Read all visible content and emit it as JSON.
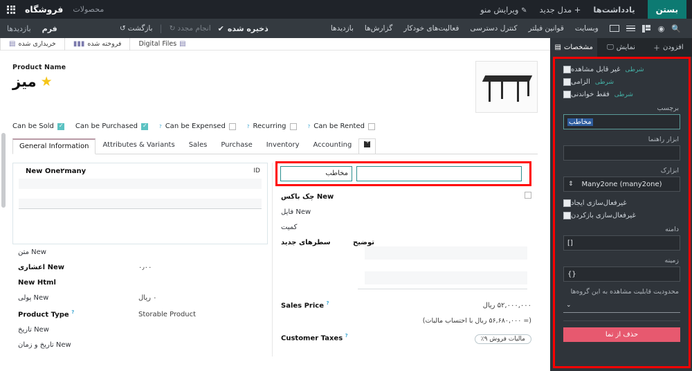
{
  "topbar": {
    "brand": "فروشگاه",
    "apps_icon": "apps-grid-icon",
    "products_link": "محصولات",
    "edit_menu": "ویرایش منو",
    "new_model": "+ مدل جدید",
    "notes": "یادداشت‌ها",
    "close_label": "بستن"
  },
  "secondbar": {
    "breadcrumb_views": "بازدیدها",
    "breadcrumb_form": "فرم",
    "menu_items": [
      "بازدیدها",
      "گزارش‌ها",
      "فعالیت‌های خودکار",
      "کنترل دسترسی",
      "قوانین فیلتر",
      "وبسایت"
    ],
    "undo": "بازگشت",
    "redo": "انجام مجدد",
    "saved": "ذخیره شده",
    "icons": [
      "search-icon",
      "clock-icon",
      "kanban-view-icon",
      "list-view-icon",
      "card-view-icon"
    ]
  },
  "statbar": {
    "buttons": [
      {
        "label": "خریداری شده",
        "icon": "purchase-icon"
      },
      {
        "label": "فروخته شده",
        "icon": "bar-chart-icon"
      },
      {
        "label": "Digital Files",
        "icon": "files-icon"
      }
    ]
  },
  "product": {
    "image_alt": "desk-product-image",
    "name_label": "Product Name",
    "name": "میز",
    "favorite_icon": "star-icon",
    "checkboxes": [
      {
        "label": "Can be Sold",
        "checked": true,
        "help": true
      },
      {
        "label": "Can be Purchased",
        "checked": true,
        "help": false
      },
      {
        "label": "Can be Expensed",
        "checked": false,
        "help": true
      },
      {
        "label": "Recurring",
        "checked": false,
        "help": true
      },
      {
        "label": "Can be Rented",
        "checked": false,
        "help": true
      }
    ]
  },
  "tabs": {
    "items": [
      "General Information",
      "Attributes & Variants",
      "Sales",
      "Purchase",
      "Inventory",
      "Accounting"
    ],
    "active": "General Information",
    "add_tab_icon": "add-tab-icon"
  },
  "form": {
    "right_column": {
      "o2m_title": "New One۲many",
      "o2m_id_col": "ID",
      "fields": [
        {
          "label": "New متن",
          "value": "",
          "bold": false,
          "help": false
        },
        {
          "label": "New اعشاری",
          "value": "۰٫۰۰",
          "bold": true,
          "help": false
        },
        {
          "label": "New Html",
          "value": "",
          "bold": true,
          "help": false
        },
        {
          "label": "New پولی",
          "value": "۰ ریال",
          "bold": false,
          "help": false
        },
        {
          "label": "Product Type",
          "value": "Storable Product",
          "bold": true,
          "help": true
        },
        {
          "label": "New تاریخ",
          "value": "",
          "bold": false,
          "help": false
        },
        {
          "label": "New تاریخ و زمان",
          "value": "",
          "bold": false,
          "help": false
        }
      ]
    },
    "left_column": {
      "contact_input_value": "مخاطب",
      "contact_input_placeholder": "مخاطب",
      "second_input_value": "",
      "fields": [
        {
          "label": "New چک باکس",
          "bold": true,
          "kind": "checkbox"
        },
        {
          "label": "New فایل",
          "bold": false,
          "kind": "text"
        },
        {
          "label": "کمیت",
          "bold": false,
          "kind": "text"
        },
        {
          "label": "سطرهای جدید",
          "bold": true,
          "kind": "list"
        }
      ],
      "list_column_header": "توضیح",
      "sales_price_label": "Sales Price",
      "sales_price_value": "۵۲,۰۰۰,۰۰۰ ریال",
      "sales_price_note": "(= ۵۶,۶۸۰,۰۰۰ ریال با احتساب مالیات)",
      "customer_taxes_label": "Customer Taxes",
      "customer_taxes_tag": "مالیات فروش ۹٪"
    }
  },
  "right_panel": {
    "tabs": [
      {
        "label": "مشخصات",
        "icon": "properties-icon",
        "active": true
      },
      {
        "label": "نمایش",
        "icon": "monitor-icon",
        "active": false
      },
      {
        "label": "افزودن",
        "icon": "plus-icon",
        "active": false
      }
    ],
    "checkbox_rows": [
      {
        "label": "غیر قابل مشاهده",
        "conditional": "شرطی",
        "checked": false
      },
      {
        "label": "الزامی",
        "conditional": "شرطی",
        "checked": false
      },
      {
        "label": "فقط خواندنی",
        "conditional": "شرطی",
        "checked": false
      }
    ],
    "label_field_label": "برچسب",
    "label_field_value": "مخاطب",
    "tooltip_label": "ابزار راهنما",
    "tooltip_value": "",
    "widget_label": "ابزارک",
    "widget_value": "Many2one (many2one)",
    "widget_icon": "updown-arrows-icon",
    "disable_create_label": "غیرفعال‌سازی ایجاد",
    "disable_open_label": "غیرفعال‌سازی بازکردن",
    "domain_label": "دامنه",
    "domain_value": "[]",
    "context_label": "زمینه",
    "context_value": "{}",
    "groups_label": "محدودیت قابلیت مشاهده به این گروه‌ها",
    "groups_value": "",
    "groups_icon": "chevron-down-icon",
    "delete_button": "حذف از نما"
  },
  "colors": {
    "accent_teal": "#0d7a72",
    "highlight_red": "#ff0000",
    "danger": "#e7596f",
    "panel_bg": "#2f343a",
    "topbar_bg": "#1f2329",
    "conditional_link": "#44b3a8",
    "star": "#f5c518"
  }
}
